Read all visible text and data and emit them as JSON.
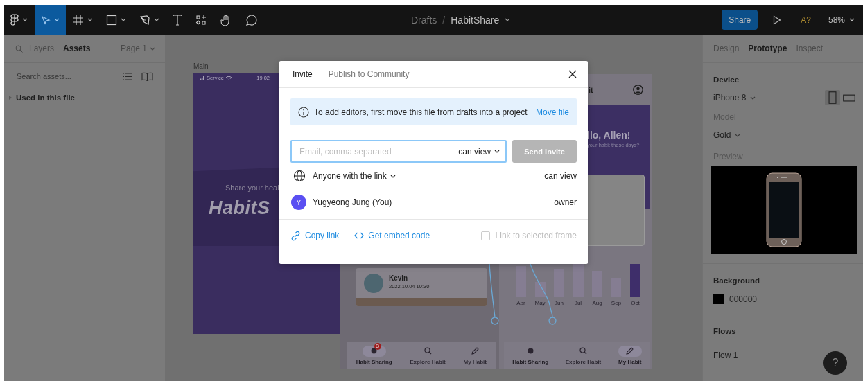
{
  "toolbar": {
    "tools": [
      {
        "kind": "logo",
        "selected": false,
        "dropdown": true
      },
      {
        "kind": "move",
        "selected": true,
        "dropdown": true
      },
      {
        "kind": "frame",
        "selected": false,
        "dropdown": true
      },
      {
        "kind": "shape",
        "selected": false,
        "dropdown": true
      },
      {
        "kind": "pen",
        "selected": false,
        "dropdown": true
      },
      {
        "kind": "text",
        "selected": false,
        "dropdown": false
      },
      {
        "kind": "components",
        "selected": false,
        "dropdown": false
      },
      {
        "kind": "hand",
        "selected": false,
        "dropdown": false
      },
      {
        "kind": "comment",
        "selected": false,
        "dropdown": false
      }
    ],
    "file": {
      "folder": "Drafts",
      "separator": "/",
      "name": "HabitShare"
    },
    "share_button": "Share",
    "font_warning": "A?",
    "zoom": "58%"
  },
  "left_panel": {
    "tabs": [
      {
        "label": "Layers",
        "selected": false
      },
      {
        "label": "Assets",
        "selected": true
      }
    ],
    "page": "Page 1",
    "search": {
      "placeholder": "Search assets..."
    },
    "sections": [
      {
        "label": "Used in this file",
        "expanded": false
      }
    ]
  },
  "canvas": {
    "frame_label": "Main",
    "main_frame": {
      "carrier": "Service",
      "time": "19:02",
      "tagline": "Share your heal",
      "logo": "HabitS"
    },
    "feed_frame": {
      "post": {
        "author": "Kevin",
        "time": "2022.10.04 10:30"
      },
      "nav": [
        {
          "label": "Habit Sharing",
          "selected": true,
          "badge": "3"
        },
        {
          "label": "Explore Habit",
          "selected": false
        },
        {
          "label": "My Habit",
          "selected": false
        }
      ]
    },
    "home_frame": {
      "title": "it",
      "greeting": "llo, Allen!",
      "question": "your habit these days?",
      "chart_months": [
        "Apr",
        "May",
        "Jun",
        "Jul",
        "Aug",
        "Sep",
        "Oct"
      ],
      "nav": [
        {
          "label": "Habit Sharing",
          "selected": false
        },
        {
          "label": "Explore Habit",
          "selected": false
        },
        {
          "label": "My Habit",
          "selected": true
        }
      ]
    }
  },
  "modal": {
    "tabs": [
      {
        "label": "Invite",
        "selected": true
      },
      {
        "label": "Publish to Community",
        "selected": false
      }
    ],
    "notice": {
      "text": "To add editors, first move this file from drafts into a project",
      "action": "Move file"
    },
    "invite": {
      "placeholder": "Email, comma separated",
      "role": "can view",
      "button": "Send invite",
      "disabled": true
    },
    "access": [
      {
        "kind": "link",
        "name": "Anyone with the link",
        "role": "can view"
      },
      {
        "kind": "user",
        "initial": "Y",
        "name": "Yugyeong Jung (You)",
        "role": "owner"
      }
    ],
    "footer": {
      "copy_link": "Copy link",
      "embed": "Get embed code",
      "frame_option": {
        "label": "Link to selected frame",
        "checked": false
      }
    }
  },
  "right_panel": {
    "tabs": [
      {
        "label": "Design",
        "selected": false
      },
      {
        "label": "Prototype",
        "selected": true
      },
      {
        "label": "Inspect",
        "selected": false
      }
    ],
    "device": {
      "heading": "Device",
      "value": "iPhone 8",
      "orientations": [
        {
          "kind": "portrait",
          "selected": true
        },
        {
          "kind": "landscape",
          "selected": false
        }
      ]
    },
    "model": {
      "label": "Model",
      "value": "Gold"
    },
    "preview_label": "Preview",
    "background": {
      "heading": "Background",
      "color": "#000000",
      "hex": "000000"
    },
    "flows": {
      "heading": "Flows",
      "items": [
        "Flow 1"
      ]
    }
  },
  "help": "?"
}
